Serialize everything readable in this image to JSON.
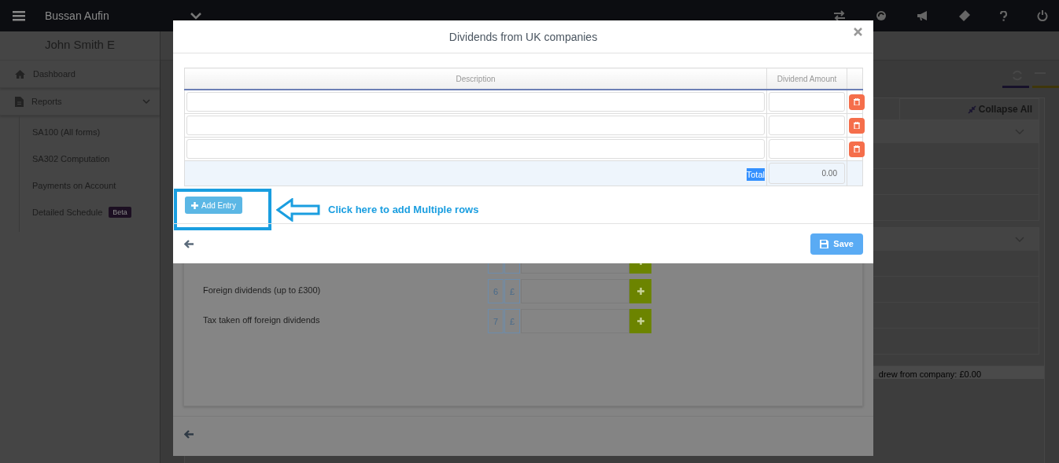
{
  "top_bar": {
    "brand": "Bussan Aufin"
  },
  "sidebar": {
    "user_name": "John Smith E",
    "items": [
      {
        "label": "Dashboard",
        "kind": "home"
      },
      {
        "label": "Reports",
        "kind": "document",
        "expanded": true,
        "children": [
          {
            "label": "SA100 (All forms)"
          },
          {
            "label": "SA302 Computation"
          },
          {
            "label": "Payments on Account"
          },
          {
            "label": "Detailed Schedule",
            "badge": "Beta"
          }
        ]
      }
    ]
  },
  "background": {
    "collapse_button": "Collapse All",
    "footer_text": "drew from company: £0.00"
  },
  "back_form": {
    "rows": [
      {
        "kind": "cut"
      },
      {
        "label": "Foreign dividends (up to £300)",
        "box_number": "6",
        "currency": "£"
      },
      {
        "label": "Tax taken off foreign dividends",
        "box_number": "7",
        "currency": "£"
      }
    ]
  },
  "modal": {
    "title": "Dividends from UK companies",
    "columns": [
      "Description",
      "Dividend Amount"
    ],
    "rows": [
      {
        "kind": "entry"
      },
      {
        "kind": "entry"
      },
      {
        "kind": "entry"
      }
    ],
    "total_label": "Total",
    "total_label_highlighted": true,
    "total_value": "0.00",
    "add_button": "Add Entry",
    "callout": "Click here to add Multiple rows",
    "save_button": "Save"
  }
}
